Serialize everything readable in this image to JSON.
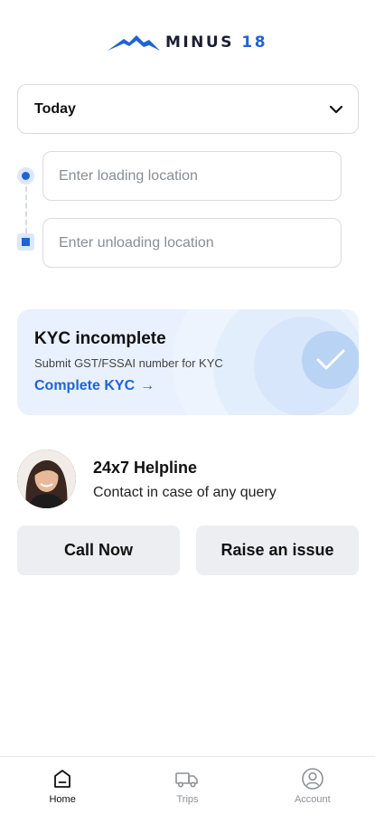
{
  "brand": {
    "name_main": "MINUS ",
    "name_num": "18",
    "accent_color": "#1f63d8"
  },
  "date_select": {
    "value": "Today",
    "icon": "chevron-down-icon"
  },
  "route": {
    "loading_placeholder": "Enter loading location",
    "unloading_placeholder": "Enter unloading location"
  },
  "kyc": {
    "title": "KYC incomplete",
    "subtitle": "Submit GST/FSSAI number for KYC",
    "link_label": "Complete KYC",
    "arrow": "→",
    "icon": "check-circle-icon"
  },
  "helpline": {
    "title": "24x7 Helpline",
    "subtitle": "Contact in case of any query",
    "call_label": "Call Now",
    "issue_label": "Raise an issue"
  },
  "bottom_nav": {
    "items": [
      {
        "label": "Home",
        "icon": "home-icon",
        "active": true
      },
      {
        "label": "Trips",
        "icon": "truck-icon",
        "active": false
      },
      {
        "label": "Account",
        "icon": "account-icon",
        "active": false
      }
    ]
  }
}
